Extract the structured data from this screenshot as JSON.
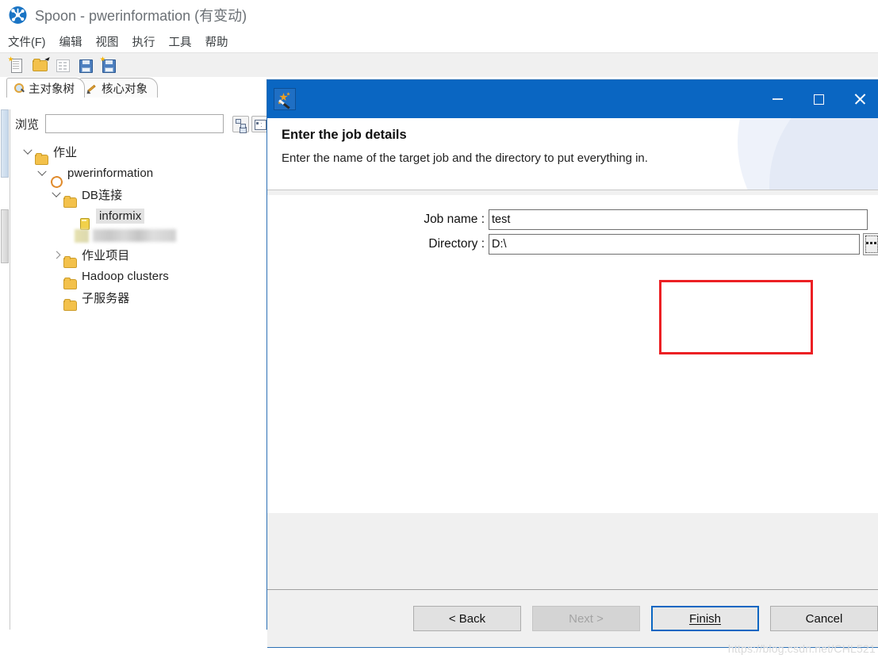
{
  "window": {
    "title": "Spoon - pwerinformation (有变动)",
    "icon": "spoon-app-icon"
  },
  "menubar": {
    "items": [
      {
        "label": "文件(F)",
        "name": "menu-file"
      },
      {
        "label": "编辑",
        "name": "menu-edit"
      },
      {
        "label": "视图",
        "name": "menu-view"
      },
      {
        "label": "执行",
        "name": "menu-run"
      },
      {
        "label": "工具",
        "name": "menu-tools"
      },
      {
        "label": "帮助",
        "name": "menu-help"
      }
    ]
  },
  "toolbar": {
    "buttons": [
      {
        "icon": "new-file-icon",
        "name": "toolbar-new"
      },
      {
        "icon": "open-folder-icon",
        "name": "toolbar-open"
      },
      {
        "icon": "explorer-list-icon",
        "name": "toolbar-explore"
      },
      {
        "icon": "save-icon",
        "name": "toolbar-save"
      },
      {
        "icon": "save-as-icon",
        "name": "toolbar-save-as"
      }
    ]
  },
  "tabs": [
    {
      "label": "主对象树",
      "icon": "magnifier-icon",
      "active": true
    },
    {
      "label": "核心对象",
      "icon": "pencil-icon",
      "active": false
    }
  ],
  "explorer": {
    "browse_label": "浏览",
    "browse_value": "",
    "browse_placeholder": "",
    "view_buttons": [
      {
        "icon": "hierarchy-icon",
        "name": "tree-view-button"
      },
      {
        "icon": "list-icon",
        "name": "list-view-button"
      }
    ],
    "tree": [
      {
        "label": "作业",
        "icon": "folder-icon",
        "depth": 0,
        "twist": "down",
        "selected": false
      },
      {
        "label": "pwerinformation",
        "icon": "job-icon",
        "depth": 1,
        "twist": "down",
        "selected": false
      },
      {
        "label": "DB连接",
        "icon": "folder-icon",
        "depth": 2,
        "twist": "down",
        "selected": false
      },
      {
        "label": "informix",
        "icon": "db-icon",
        "depth": 3,
        "twist": "none",
        "selected": true
      },
      {
        "label": "",
        "icon": "blurred",
        "depth": 3,
        "twist": "none",
        "selected": false
      },
      {
        "label": "作业项目",
        "icon": "folder-icon",
        "depth": 2,
        "twist": "right",
        "selected": false
      },
      {
        "label": "Hadoop clusters",
        "icon": "folder-icon",
        "depth": 2,
        "twist": "none",
        "selected": false
      },
      {
        "label": "子服务器",
        "icon": "folder-icon",
        "depth": 2,
        "twist": "none",
        "selected": false
      }
    ]
  },
  "dialog": {
    "icon": "wizard-wand-icon",
    "controls": {
      "minimize": "minimize-icon",
      "maximize": "maximize-icon",
      "close": "close-icon"
    },
    "heading": "Enter the job details",
    "subheading": "Enter the name of the target job and the directory to put everything in.",
    "fields": [
      {
        "label": "Job name :",
        "value": "test",
        "name": "job-name-field"
      },
      {
        "label": "Directory :",
        "value": "D:\\",
        "name": "directory-field"
      }
    ],
    "browse_button": "...",
    "buttons": [
      {
        "label": "< Back",
        "underline": "B",
        "state": "enabled",
        "name": "back-button"
      },
      {
        "label": "Next >",
        "underline": "N",
        "state": "disabled",
        "name": "next-button"
      },
      {
        "label": "Finish",
        "underline": "F",
        "state": "default",
        "name": "finish-button"
      },
      {
        "label": "Cancel",
        "underline": "",
        "state": "enabled",
        "name": "cancel-button"
      }
    ],
    "highlight_color": "#ec2024",
    "accent_color": "#0a66c2"
  },
  "watermark": "https://blog.csdn.net/CHL521"
}
